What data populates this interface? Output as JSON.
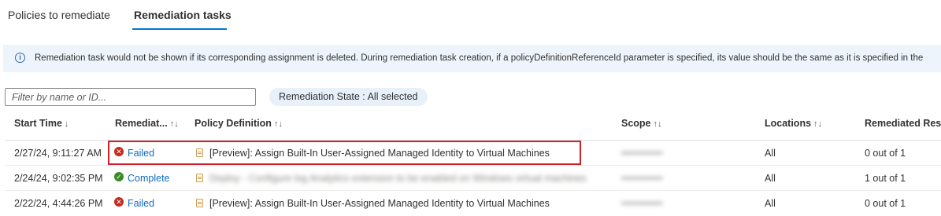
{
  "tabs": [
    {
      "label": "Policies to remediate",
      "active": false
    },
    {
      "label": "Remediation tasks",
      "active": true
    }
  ],
  "info_banner": {
    "icon": "info-icon",
    "text": "Remediation task would not be shown if its corresponding assignment is deleted. During remediation task creation, if a policyDefinitionReferenceId parameter is specified, its value should be the same as it is specified in the"
  },
  "filter": {
    "placeholder": "Filter by name or ID...",
    "value": ""
  },
  "state_filter": {
    "label": "Remediation State : ",
    "value": "All selected"
  },
  "table": {
    "columns": [
      {
        "label": "Start Time",
        "sort": "↓"
      },
      {
        "label": "Remediat...",
        "sort": "↑↓"
      },
      {
        "label": "Policy Definition",
        "sort": "↑↓"
      },
      {
        "label": "Scope",
        "sort": "↑↓"
      },
      {
        "label": "Locations",
        "sort": "↑↓"
      },
      {
        "label": "Remediated Reso",
        "sort": ""
      }
    ],
    "rows": [
      {
        "start_time": "2/27/24, 9:11:27 AM",
        "state": "Failed",
        "state_icon": "error-x-icon",
        "policy": "[Preview]: Assign Built-In User-Assigned Managed Identity to Virtual Machines",
        "policy_redacted": false,
        "scope": "••••••••••••",
        "location": "All",
        "remediated": "0 out of 1"
      },
      {
        "start_time": "2/24/24, 9:02:35 PM",
        "state": "Complete",
        "state_icon": "checkmark-icon",
        "policy": "Deploy - Configure log Analytics extension to be enabled on Windows virtual machines",
        "policy_redacted": true,
        "scope": "••••••••••••",
        "location": "All",
        "remediated": "1 out of 1"
      },
      {
        "start_time": "2/22/24, 4:44:26 PM",
        "state": "Failed",
        "state_icon": "error-x-icon",
        "policy": "[Preview]: Assign Built-In User-Assigned Managed Identity to Virtual Machines",
        "policy_redacted": false,
        "scope": "••••••••••••",
        "location": "All",
        "remediated": "0 out of 1"
      }
    ]
  },
  "colors": {
    "accent": "#0078d4",
    "failed": "#c42b1c",
    "complete": "#3b8c24",
    "link": "#0f6cbd",
    "highlight": "#d31f2a"
  }
}
